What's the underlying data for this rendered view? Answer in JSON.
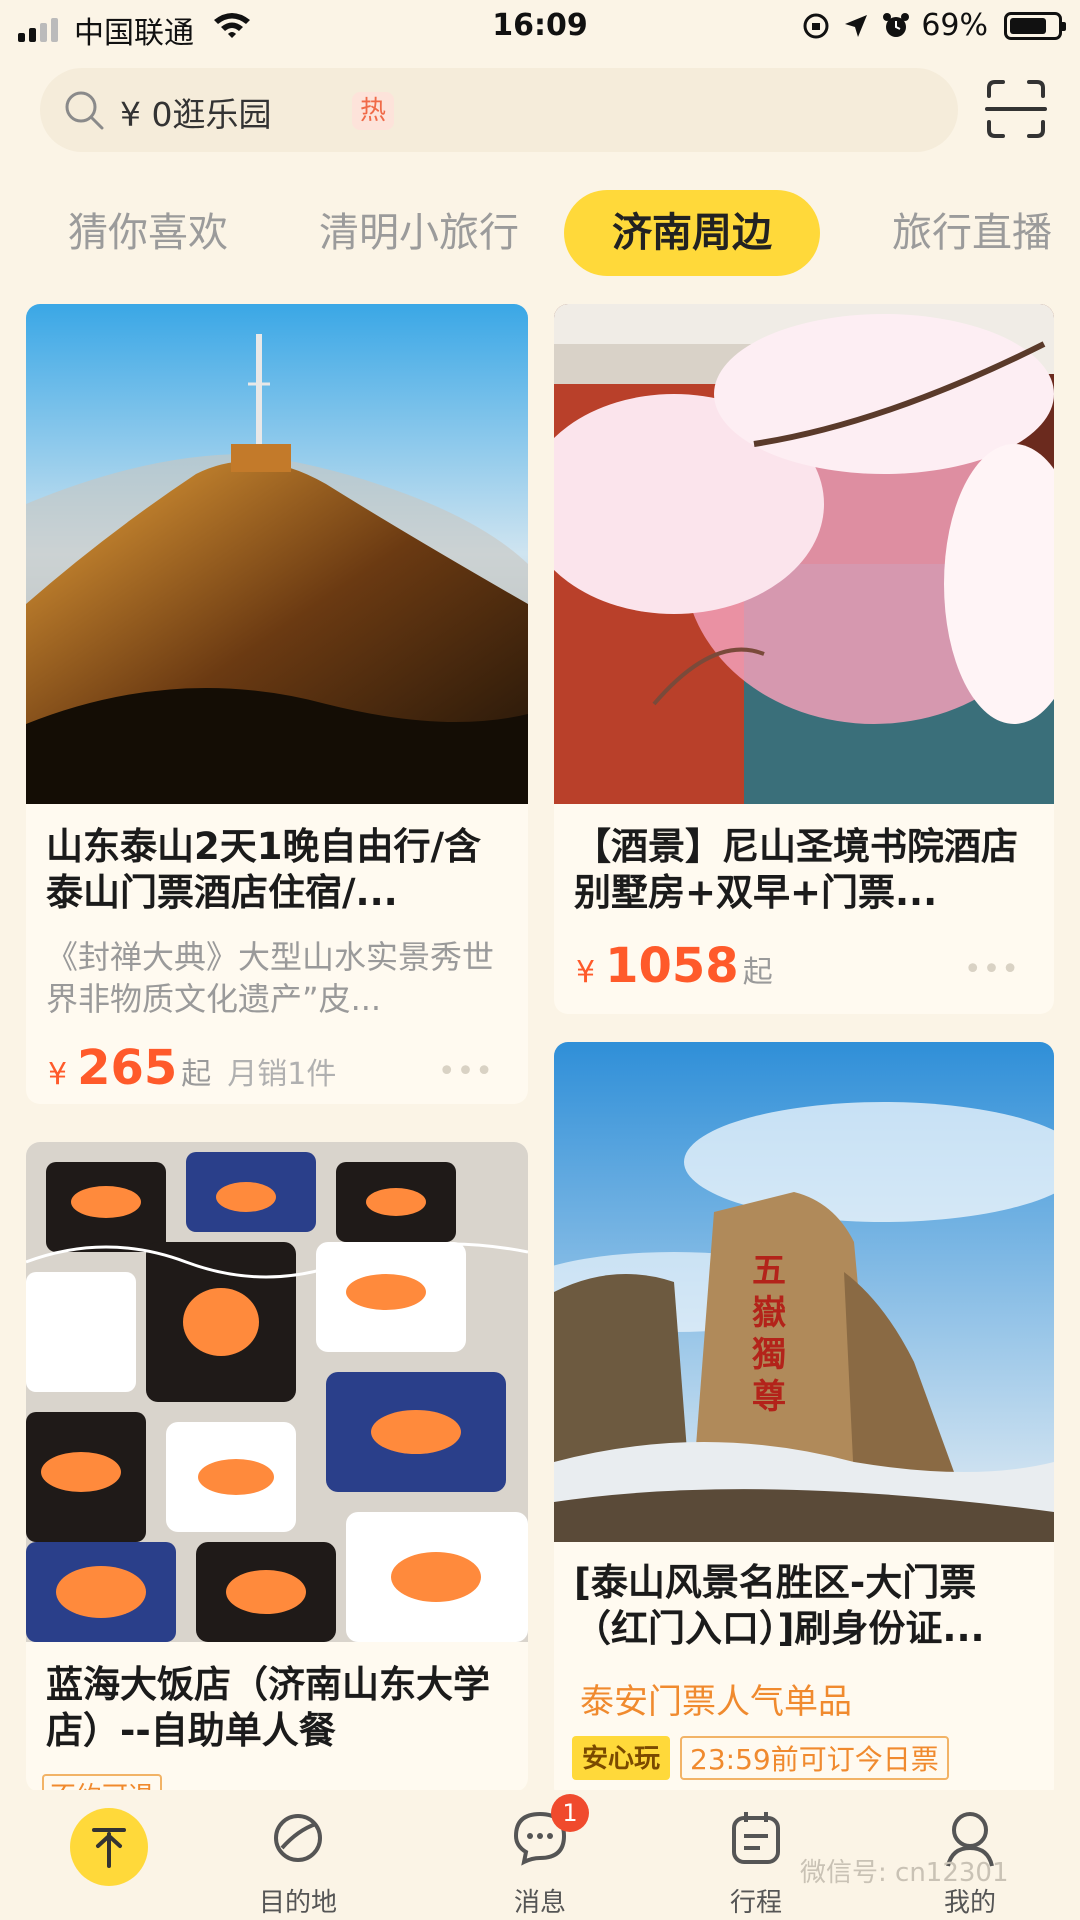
{
  "status_bar": {
    "carrier": "中国联通",
    "time": "16:09",
    "battery": "69%",
    "battery_level": 0.69
  },
  "search": {
    "placeholder": "¥ 0逛乐园",
    "hot_tag": "热"
  },
  "tabs": [
    {
      "label": "猜你喜欢",
      "active": false
    },
    {
      "label": "清明小旅行",
      "active": false
    },
    {
      "label": "济南周边",
      "active": true
    },
    {
      "label": "旅行直播",
      "active": false
    }
  ],
  "cards": [
    {
      "title": "山东泰山2天1晚自由行/含泰山门票酒店住宿/...",
      "subtitle": "《封禅大典》大型山水实景秀世界非物质文化遗产”皮...",
      "price_symbol": "¥",
      "price": "265",
      "price_suffix": "起",
      "sales": "月销1件",
      "more": "•••",
      "image_icon": "mountain-summit-photo"
    },
    {
      "title": "【酒景】尼山圣境书院酒店别墅房+双早+门票...",
      "price_symbol": "¥",
      "price": "1058",
      "price_suffix": "起",
      "more": "•••",
      "image_icon": "cherry-blossom-photo"
    },
    {
      "title": "蓝海大饭店（济南山东大学店）--自助单人餐",
      "tag_partial": "不约可退",
      "image_icon": "sashimi-buffet-photo"
    },
    {
      "title": "[泰山风景名胜区-大门票（红门入口）]刷身份证...",
      "highlight": "泰安门票人气单品",
      "badge_primary": "安心玩",
      "badge_secondary": "23:59前可订今日票",
      "image_icon": "wuyue-duzun-rock-photo"
    }
  ],
  "bottom_nav": [
    {
      "label": "",
      "icon": "home-top-icon"
    },
    {
      "label": "目的地",
      "icon": "planet-icon"
    },
    {
      "label": "消息",
      "icon": "chat-icon",
      "badge": "1"
    },
    {
      "label": "行程",
      "icon": "itinerary-icon"
    },
    {
      "label": "我的",
      "icon": "profile-icon"
    }
  ],
  "watermark": "微信号: cn12301",
  "colors": {
    "background": "#fbf4e6",
    "accent_yellow": "#ffd93a",
    "price_orange": "#ff5a2a",
    "badge_red": "#f04a2d"
  }
}
